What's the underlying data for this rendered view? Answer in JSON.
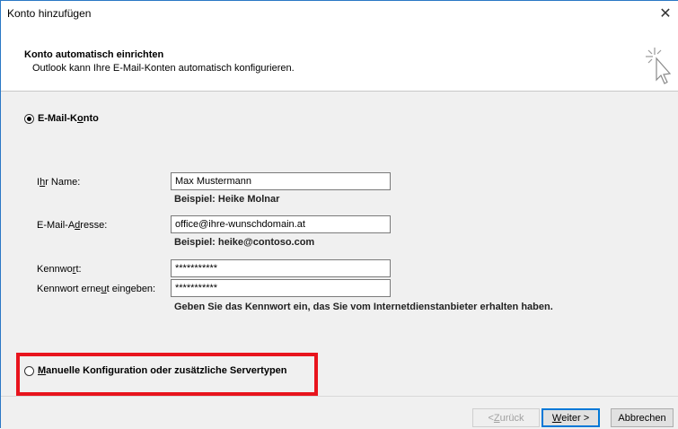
{
  "window": {
    "title": "Konto hinzufügen",
    "close_glyph": "✕"
  },
  "header": {
    "title": "Konto automatisch einrichten",
    "subtitle": "Outlook kann Ihre E-Mail-Konten automatisch konfigurieren.",
    "icon": "cursor-sparkle-icon"
  },
  "email_option": {
    "label_pre": "E-Mail-K",
    "label_u": "o",
    "label_post": "nto",
    "selected": true
  },
  "fields": {
    "name": {
      "label_pre": "I",
      "label_u": "h",
      "label_post": "r Name:",
      "value": "Max Mustermann",
      "hint": "Beispiel: Heike Molnar"
    },
    "email": {
      "label_pre": "E-Mail-A",
      "label_u": "d",
      "label_post": "resse:",
      "value": "office@ihre-wunschdomain.at",
      "hint": "Beispiel: heike@contoso.com"
    },
    "password": {
      "label_pre": "Kennwo",
      "label_u": "r",
      "label_post": "t:",
      "value": "***********"
    },
    "password_confirm": {
      "label_pre": "Kennwort erne",
      "label_u": "u",
      "label_post": "t eingeben:",
      "value": "***********",
      "hint": "Geben Sie das Kennwort ein, das Sie vom Internetdienstanbieter erhalten haben."
    }
  },
  "manual_option": {
    "label_u": "M",
    "label_post": "anuelle Konfiguration oder zusätzliche Servertypen",
    "selected": false
  },
  "buttons": {
    "back_pre": "< ",
    "back_u": "Z",
    "back_post": "urück",
    "next_u": "W",
    "next_post": "eiter >",
    "cancel": "Abbrechen"
  },
  "colors": {
    "highlight_box": "#e8141d",
    "primary_button_border": "#0078d7"
  }
}
